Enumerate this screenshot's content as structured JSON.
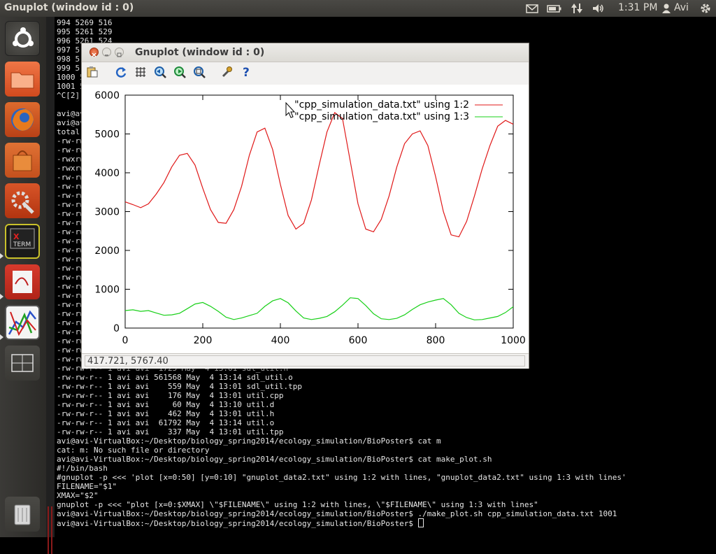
{
  "top_panel": {
    "title": "Gnuplot (window id : 0)",
    "clock": "1:31 PM",
    "user": "Avi"
  },
  "launcher": {
    "items": [
      "ubuntu-dash",
      "files",
      "firefox",
      "software-center",
      "system-settings",
      "xterm",
      "text-editor",
      "gnuplot",
      "workspace-switcher",
      "trash"
    ]
  },
  "terminal": {
    "lines": [
      "994 5269 516",
      "995 5261 529",
      "996 5261 524",
      "997 5",
      "998 5",
      "999 5",
      "1000 5",
      "1001 5",
      "^C[2]-",
      "",
      "avi@av",
      "avi@av",
      "total ",
      "-rw-rw",
      "-rw-rw",
      "-rwxrw",
      "-rwxrw",
      "-rw-rw",
      "-rw-rw",
      "-rw-rw",
      "-rw-rw",
      "-rw-rw",
      "-rw-rw",
      "-rw-rw",
      "-rw-rw",
      "-rw-rw",
      "-rw-rw",
      "-rw-rw",
      "-rw-rw",
      "-rw-rw",
      "-rw-rw",
      "-rw-rw",
      "-rw-rw",
      "-rw-rw",
      "-rw-rw",
      "-rw-rw",
      "-rw-rw",
      "-rw-rw",
      "-rw-rw-r-- 1 avi avi  1725 May  4 13:01 sdl_util.h",
      "-rw-rw-r-- 1 avi avi 561568 May  4 13:14 sdl_util.o",
      "-rw-rw-r-- 1 avi avi    559 May  4 13:01 sdl_util.tpp",
      "-rw-rw-r-- 1 avi avi    176 May  4 13:01 util.cpp",
      "-rw-rw-r-- 1 avi avi     60 May  4 13:10 util.d",
      "-rw-rw-r-- 1 avi avi    462 May  4 13:01 util.h",
      "-rw-rw-r-- 1 avi avi  61792 May  4 13:14 util.o",
      "-rw-rw-r-- 1 avi avi    337 May  4 13:01 util.tpp",
      "avi@avi-VirtualBox:~/Desktop/biology_spring2014/ecology_simulation/BioPoster$ cat m",
      "cat: m: No such file or directory",
      "avi@avi-VirtualBox:~/Desktop/biology_spring2014/ecology_simulation/BioPoster$ cat make_plot.sh",
      "#!/bin/bash",
      "#gnuplot -p <<< 'plot [x=0:50] [y=0:10] \"gnuplot_data2.txt\" using 1:2 with lines, \"gnuplot_data2.txt\" using 1:3 with lines'",
      "FILENAME=\"$1\"",
      "XMAX=\"$2\"",
      "gnuplot -p <<< \"plot [x=0:$XMAX] \\\"$FILENAME\\\" using 1:2 with lines, \\\"$FILENAME\\\" using 1:3 with lines\"",
      "avi@avi-VirtualBox:~/Desktop/biology_spring2014/ecology_simulation/BioPoster$ ./make_plot.sh cpp_simulation_data.txt 1001",
      "avi@avi-VirtualBox:~/Desktop/biology_spring2014/ecology_simulation/BioPoster$ "
    ]
  },
  "gnuplot_window": {
    "title": "Gnuplot (window id : 0)",
    "toolbar": [
      "copy-to-clipboard",
      "replot",
      "toggle-grid",
      "previous-zoom",
      "next-zoom",
      "autoscale",
      "options",
      "help"
    ],
    "status": "417.721, 5767.40"
  },
  "colors": {
    "series1": "#e01818",
    "series2": "#18d018",
    "panel_bg": "#3c3b37",
    "launcher_bg": "#2c2b28"
  },
  "chart_data": {
    "type": "line",
    "title": "",
    "xlabel": "",
    "ylabel": "",
    "xlim": [
      0,
      1000
    ],
    "ylim": [
      0,
      6000
    ],
    "xticks": [
      0,
      200,
      400,
      600,
      800,
      1000
    ],
    "yticks": [
      0,
      1000,
      2000,
      3000,
      4000,
      5000,
      6000
    ],
    "x_tick_labels": [
      "0",
      "200",
      "400",
      "600",
      "800",
      "1000"
    ],
    "y_tick_labels": [
      "0",
      "1000",
      "2000",
      "3000",
      "4000",
      "5000",
      "6000"
    ],
    "legend_position": "top-right",
    "grid": false,
    "series": [
      {
        "name": "\"cpp_simulation_data.txt\" using 1:2",
        "color": "#e01818",
        "x": [
          0,
          20,
          40,
          60,
          80,
          100,
          120,
          140,
          160,
          180,
          200,
          220,
          240,
          260,
          280,
          300,
          320,
          340,
          360,
          380,
          400,
          420,
          440,
          460,
          480,
          500,
          520,
          540,
          560,
          580,
          600,
          620,
          640,
          660,
          680,
          700,
          720,
          740,
          760,
          780,
          800,
          820,
          840,
          860,
          880,
          900,
          920,
          940,
          960,
          980,
          1000
        ],
        "y": [
          3250,
          3180,
          3100,
          3200,
          3450,
          3750,
          4150,
          4450,
          4500,
          4200,
          3600,
          3050,
          2720,
          2700,
          3050,
          3650,
          4450,
          5050,
          5150,
          4600,
          3700,
          2900,
          2550,
          2700,
          3300,
          4200,
          5050,
          5550,
          5400,
          4300,
          3200,
          2550,
          2480,
          2800,
          3400,
          4150,
          4750,
          5000,
          5080,
          4700,
          3900,
          3000,
          2400,
          2350,
          2750,
          3400,
          4100,
          4700,
          5200,
          5350,
          5250
        ]
      },
      {
        "name": "\"cpp_simulation_data.txt\" using 1:3",
        "color": "#18d018",
        "x": [
          0,
          20,
          40,
          60,
          80,
          100,
          120,
          140,
          160,
          180,
          200,
          220,
          240,
          260,
          280,
          300,
          320,
          340,
          360,
          380,
          400,
          420,
          440,
          460,
          480,
          500,
          520,
          540,
          560,
          580,
          600,
          620,
          640,
          660,
          680,
          700,
          720,
          740,
          760,
          780,
          800,
          820,
          840,
          860,
          880,
          900,
          920,
          940,
          960,
          980,
          1000
        ],
        "y": [
          450,
          470,
          430,
          450,
          390,
          330,
          340,
          380,
          500,
          620,
          660,
          560,
          430,
          280,
          220,
          260,
          320,
          380,
          560,
          700,
          760,
          650,
          440,
          260,
          220,
          250,
          300,
          420,
          590,
          780,
          760,
          580,
          370,
          240,
          220,
          250,
          340,
          480,
          600,
          670,
          720,
          760,
          600,
          380,
          270,
          210,
          220,
          260,
          300,
          400,
          550
        ]
      }
    ]
  }
}
